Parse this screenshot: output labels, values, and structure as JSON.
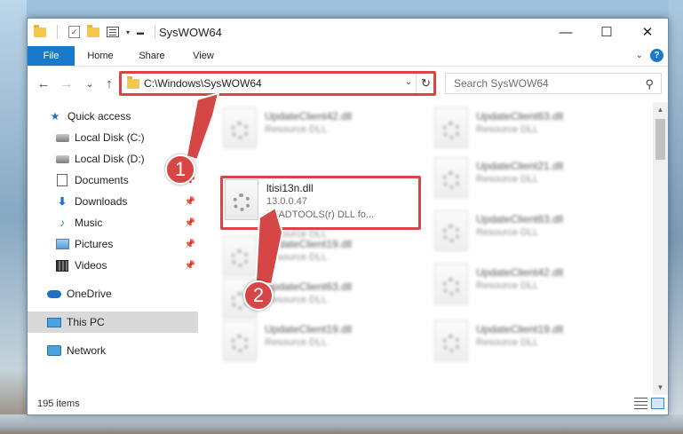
{
  "window": {
    "title": "SysWOW64",
    "controls": {
      "minimize": "—",
      "maximize": "☐",
      "close": "✕"
    }
  },
  "ribbon": {
    "tabs": [
      "File",
      "Home",
      "Share",
      "View"
    ],
    "help": "?"
  },
  "nav": {
    "back": "←",
    "forward": "→",
    "recent": "⌄",
    "up": "↑",
    "address": "C:\\Windows\\SysWOW64",
    "search_placeholder": "Search SysWOW64"
  },
  "sidebar": {
    "items": [
      {
        "label": "Quick access",
        "icon": "star-icon"
      },
      {
        "label": "Local Disk (C:)",
        "icon": "drive-icon"
      },
      {
        "label": "Local Disk (D:)",
        "icon": "drive-icon"
      },
      {
        "label": "Documents",
        "icon": "document-icon"
      },
      {
        "label": "Downloads",
        "icon": "download-icon"
      },
      {
        "label": "Music",
        "icon": "music-icon"
      },
      {
        "label": "Pictures",
        "icon": "pictures-icon"
      },
      {
        "label": "Videos",
        "icon": "videos-icon"
      },
      {
        "label": "OneDrive",
        "icon": "cloud-icon"
      },
      {
        "label": "This PC",
        "icon": "pc-icon"
      },
      {
        "label": "Network",
        "icon": "network-icon"
      }
    ]
  },
  "files": {
    "highlighted": {
      "name": "ltisi13n.dll",
      "version": "13.0.0.47",
      "description": "LEADTOOLS(r) DLL fo..."
    },
    "left_column": [
      {
        "name": "UpdateClient42.dll",
        "sub": "Resource DLL"
      },
      {
        "name": "",
        "sub": "Resource DLL"
      },
      {
        "name": "UpdateClient19.dll",
        "sub": "Resource DLL"
      },
      {
        "name": "UpdateClient63.dll",
        "sub": "Resource DLL"
      },
      {
        "name": "UpdateClient19.dll",
        "sub": "Resource DLL"
      }
    ],
    "right_column": [
      {
        "name": "UpdateClient63.dll",
        "sub": "Resource DLL"
      },
      {
        "name": "UpdateClient21.dll",
        "sub": "Resource DLL"
      },
      {
        "name": "UpdateClient63.dll",
        "sub": "Resource DLL"
      },
      {
        "name": "UpdateClient42.dll",
        "sub": "Resource DLL"
      },
      {
        "name": "UpdateClient19.dll",
        "sub": "Resource DLL"
      }
    ]
  },
  "status": {
    "count": "195 items"
  },
  "annotations": {
    "marker1": "1",
    "marker2": "2"
  },
  "colors": {
    "accent": "#1979ca",
    "highlight": "#d64646"
  }
}
